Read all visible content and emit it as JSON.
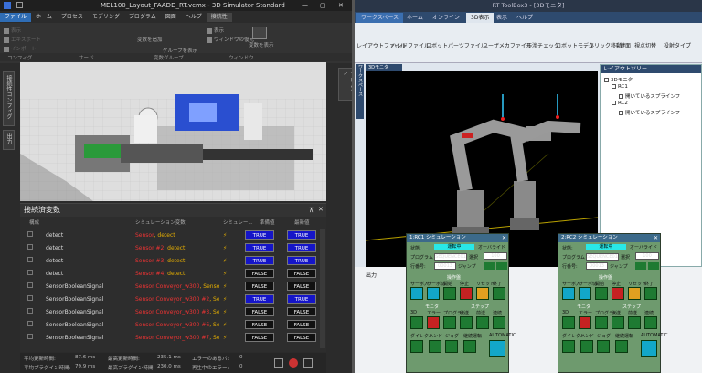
{
  "left": {
    "title": "MEL100_Layout_FAADD_RT.vcmx - 3D Simulator Standard",
    "tabs": [
      "ファイル",
      "ホーム",
      "プロセス",
      "モデリング",
      "プログラム",
      "図面",
      "ヘルプ",
      "接続性"
    ],
    "active_tab": "ファイル",
    "ribbon": {
      "items": [
        "表示",
        "ウィンドウの復元",
        "変数を表示",
        "ゲループを表示",
        "変数を追加"
      ],
      "groups": [
        "コンフィグ",
        "サーバ",
        "変数グループ",
        "ウィンドウ"
      ]
    },
    "side_tabs": [
      "接続性コンフィグ",
      "出力",
      "プロパティ"
    ],
    "variables_panel": {
      "title": "接続済変数",
      "columns": [
        "構成",
        "シミュレーション変数",
        "シミュレー...",
        "準備値",
        "最新値"
      ],
      "rows": [
        {
          "name": "detect",
          "sim": "Sensor",
          "sim2": "detect",
          "val": "TRUE",
          "t": true
        },
        {
          "name": "detect",
          "sim": "Sensor #2",
          "sim2": "detect",
          "val": "TRUE",
          "t": true
        },
        {
          "name": "detect",
          "sim": "Sensor #3",
          "sim2": "detect",
          "val": "TRUE",
          "t": true
        },
        {
          "name": "detect",
          "sim": "Sensor #4",
          "sim2": "detect",
          "val": "FALSE",
          "t": false
        },
        {
          "name": "SensorBooleanSignal",
          "sim": "Sensor Conveyor_w300",
          "sim2": "SensorBoo",
          "val": "FALSE",
          "t": false
        },
        {
          "name": "SensorBooleanSignal",
          "sim": "Sensor Conveyor_w300 #2",
          "sim2": "Sensor",
          "val": "TRUE",
          "t": true
        },
        {
          "name": "SensorBooleanSignal",
          "sim": "Sensor Conveyor_w300 #3",
          "sim2": "Sensor",
          "val": "FALSE",
          "t": false
        },
        {
          "name": "SensorBooleanSignal",
          "sim": "Sensor Conveyor_w300 #6",
          "sim2": "Sensor",
          "val": "FALSE",
          "t": false
        },
        {
          "name": "SensorBooleanSignal",
          "sim": "Sensor Conveyor_w300 #7",
          "sim2": "Sensor",
          "val": "FALSE",
          "t": false
        }
      ]
    },
    "status": {
      "avg_update_label": "平均更新時間:",
      "avg_update": "87.6 ms",
      "max_update_label": "最高更新時間:",
      "max_update": "235.1 ms",
      "error_label": "エラーのあるバ:",
      "error_value": "0",
      "avg_plugin_label": "平均プラグイン時間:",
      "avg_plugin": "79.9 ms",
      "max_plugin_label": "最高プラグイン時間:",
      "max_plugin": "230.0 ms",
      "restart_label": "再生中のエラー:",
      "restart_value": "0"
    }
  },
  "right": {
    "title": "RT ToolBox3 - [3Dモニタ]",
    "tabs": [
      "ワークスペース",
      "ホーム",
      "オンライン",
      "3D表示",
      "表示",
      "ヘルプ"
    ],
    "active_tab": "3D表示",
    "ribbon": [
      "レイアウトファイル",
      "ハンドファイル",
      "ロボットパーツファイル",
      "ユーザメカファイル",
      "干渉チェック",
      "ロボットモデル",
      "クリック移動",
      "鍵面",
      "視点切替",
      "投射タイプ"
    ],
    "monitor_tab": "3Dモニタ",
    "side_tab": "ワークスペース",
    "tree": {
      "title": "レイアウトツリー",
      "items": [
        "3Dモニタ",
        "RC1",
        "開いているスプラインフ",
        "RC2",
        "開いているスプラインフ"
      ]
    },
    "output_label": "出力",
    "sim_panels": [
      {
        "title": "1:RC1 シミュレーション",
        "state_label": "状態:",
        "state": "運転中",
        "program_label": "プログラム",
        "program": "SEQUENCE01",
        "line_label": "行番号:",
        "line": "00013",
        "select": "選択",
        "jump": "ジャンプ",
        "override_label": "オーバライド",
        "override": "100",
        "sections": [
          "操作盤",
          "モニタ",
          "ステップ"
        ],
        "buttons": [
          "サーボ入",
          "サーボ切",
          "開始",
          "停止",
          "リセット",
          "終了"
        ],
        "buttons2": [
          "3D",
          "エラー",
          "プログラム",
          "後送",
          "前送",
          "連続"
        ],
        "buttons3": [
          "ダイレクト",
          "ハンド",
          "ジョグ",
          "継続運転",
          "AUTOMATIC"
        ]
      },
      {
        "title": "2:RC2 シミュレーション",
        "state_label": "状態:",
        "state": "運転中",
        "program_label": "プログラム",
        "program": "SEQUENCE01",
        "line_label": "行番号:",
        "line": "00013",
        "select": "選択",
        "jump": "ジャンプ",
        "override_label": "オーバライド",
        "override": "100",
        "sections": [
          "操作盤",
          "モニタ",
          "ステップ"
        ],
        "buttons": [
          "サーボ入",
          "サーボ切",
          "開始",
          "停止",
          "リセット",
          "終了"
        ],
        "buttons2": [
          "3D",
          "エラー",
          "プログラム",
          "後送",
          "前送",
          "連続"
        ],
        "buttons3": [
          "ダイレクト",
          "ハンド",
          "ジョグ",
          "継続運転",
          "AUTOMATIC"
        ]
      }
    ]
  }
}
